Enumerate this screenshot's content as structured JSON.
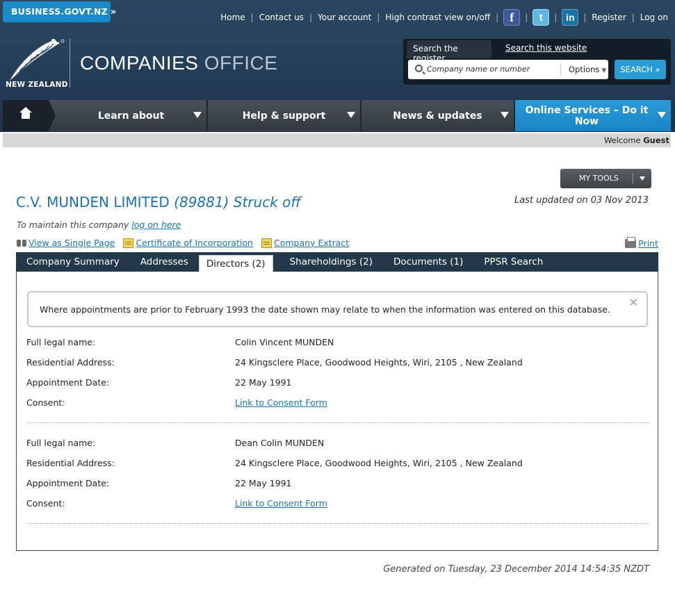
{
  "header": {
    "biz_tab": "BUSINESS.GOVT.NZ",
    "biz_tab_arrow": "»",
    "top_links": [
      "Home",
      "Contact us",
      "Your account",
      "High contrast view on/off"
    ],
    "social": {
      "facebook": "f",
      "twitter": "t",
      "linkedin": "in"
    },
    "register": "Register",
    "login": "Log on",
    "logo_caption": "NEW ZEALAND",
    "title_main": "COMPANIES",
    "title_light": " OFFICE"
  },
  "search": {
    "tab_register": "Search the register",
    "tab_site": "Search this website",
    "placeholder": "Company name or number",
    "options": "Options",
    "button": "SEARCH »"
  },
  "nav": {
    "items": [
      "Learn about",
      "Help & support",
      "News & updates"
    ],
    "online_line1": "Online Services – Do it",
    "online_line2": "Now"
  },
  "welcome": {
    "prefix": "Welcome ",
    "user": "Guest"
  },
  "tools": {
    "label": "MY TOOLS"
  },
  "company": {
    "name": "C.V. MUNDEN LIMITED",
    "status": " (89881) Struck off",
    "last_updated": "Last updated on 03 Nov 2013",
    "maintain_text": "To maintain this company ",
    "maintain_link": "log on here"
  },
  "doc_links": {
    "single_page": "View as Single Page ",
    "certificate": "Certificate of Incorporation ",
    "extract": "Company Extract",
    "print": "Print"
  },
  "tabs": [
    "Company Summary",
    "Addresses",
    "Directors (2)",
    "Shareholdings (2)",
    "Documents (1)",
    "PPSR Search"
  ],
  "notice": {
    "text": "Where appointments are prior to February 1993 the date shown may relate to when the information was entered on this database.",
    "close": "×"
  },
  "labels": {
    "full_name": "Full legal name:",
    "address": "Residential Address:",
    "appointment": "Appointment Date:",
    "consent": "Consent:"
  },
  "directors": [
    {
      "name": "Colin Vincent MUNDEN",
      "address": "24 Kingsclere Place, Goodwood Heights, Wiri, 2105 , New Zealand",
      "appointment": "22 May 1991",
      "consent": "Link to Consent Form"
    },
    {
      "name": "Dean Colin MUNDEN",
      "address": "24 Kingsclere Place, Goodwood Heights, Wiri, 2105 , New Zealand",
      "appointment": "22 May 1991",
      "consent": "Link to Consent Form"
    }
  ],
  "footer": {
    "generated": "Generated on Tuesday, 23 December 2014 14:54:35 NZDT"
  },
  "colors": {
    "brand_blue": "#1a73b0",
    "online_blue": "#1984c4",
    "header_navy": "#26405a"
  }
}
